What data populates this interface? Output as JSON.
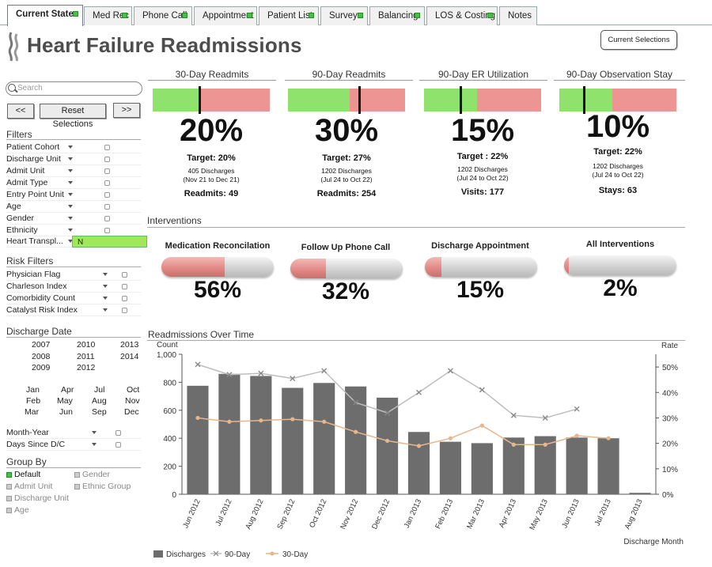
{
  "tabs": [
    {
      "label": "Current State",
      "active": true,
      "indicator": true
    },
    {
      "label": "Med Rec",
      "active": false,
      "indicator": true
    },
    {
      "label": "Phone Call",
      "active": false,
      "indicator": true
    },
    {
      "label": "Appointment",
      "active": false,
      "indicator": true
    },
    {
      "label": "Patient List",
      "active": false,
      "indicator": true
    },
    {
      "label": "Surveys",
      "active": false,
      "indicator": true
    },
    {
      "label": "Balancing",
      "active": false,
      "indicator": true
    },
    {
      "label": "LOS & Costing",
      "active": false,
      "indicator": true
    },
    {
      "label": "Notes",
      "active": false,
      "indicator": false
    }
  ],
  "header": {
    "title": "Heart Failure Readmissions",
    "current_selections_label": "Current Selections"
  },
  "left": {
    "search_placeholder": "Search",
    "prev_label": "<<",
    "reset_label": "Reset Selections",
    "next_label": ">>",
    "filters_title": "Filters",
    "filters": [
      "Patient Cohort",
      "Discharge Unit",
      "Admit Unit",
      "Admit Type",
      "Entry Point Unit",
      "Age",
      "Gender",
      "Ethnicity",
      "Heart Transpl..."
    ],
    "heart_transplant_value": "N",
    "risk_title": "Risk Filters",
    "risk_filters": [
      "Physician Flag",
      "Charleson Index",
      "Comorbidity Count",
      "Catalyst Risk Index"
    ],
    "discharge_date_title": "Discharge Date",
    "years": [
      "2007",
      "2010",
      "2013",
      "2008",
      "2011",
      "2014",
      "2009",
      "2012"
    ],
    "months": [
      "Jan",
      "Apr",
      "Jul",
      "Oct",
      "Feb",
      "May",
      "Aug",
      "Nov",
      "Mar",
      "Jun",
      "Sep",
      "Dec"
    ],
    "other_filters": [
      "Month-Year",
      "Days Since D/C"
    ],
    "group_by_title": "Group By",
    "group_by_left": [
      "Default",
      "Admit Unit",
      "Discharge Unit",
      "Age"
    ],
    "group_by_right": [
      "Gender",
      "Ethnic Group"
    ],
    "group_by_selected": "Default"
  },
  "kpis": [
    {
      "title": "30-Day Readmits",
      "value": "20%",
      "target": "Target: 20%",
      "discharges": "405 Discharges",
      "range": "(Nov 21 to Dec 21)",
      "footer": "Readmits: 49",
      "green_fraction": 0.41,
      "marker_fraction": 0.4
    },
    {
      "title": "90-Day Readmits",
      "value": "30%",
      "target": "Target: 27%",
      "discharges": "1202 Discharges",
      "range": "(Jul 24 to Oct 22)",
      "footer": "Readmits: 254",
      "green_fraction": 0.53,
      "marker_fraction": 0.61
    },
    {
      "title": "90-Day ER Utilization",
      "value": "15%",
      "target": "Target : 22%",
      "discharges": "1202 Discharges",
      "range": "(Jul 24 to Oct 22)",
      "footer": "Visits:  177",
      "green_fraction": 0.45,
      "marker_fraction": 0.31
    },
    {
      "title": "90-Day Observation Stay",
      "value": "10%",
      "target": "Target: 22%",
      "discharges": "1202 Discharges",
      "range": "(Jul 24 to Oct 22)",
      "footer": "Stays: 63",
      "green_fraction": 0.45,
      "marker_fraction": 0.21
    }
  ],
  "interventions_title": "Interventions",
  "interventions": [
    {
      "title": "Medication Reconcilation",
      "value": "56%",
      "fraction": 0.56
    },
    {
      "title": "Follow Up Phone Call",
      "value": "32%",
      "fraction": 0.32
    },
    {
      "title": "Discharge Appointment",
      "value": "15%",
      "fraction": 0.15
    },
    {
      "title": "All Interventions",
      "value": "2%",
      "fraction": 0.02
    }
  ],
  "chart_section_title": "Readmissions Over Time",
  "colors": {
    "gauge_green": "#8fe26b",
    "gauge_red": "#ec9593",
    "bar": "#6d6d6d",
    "line_90": "#bdbdbd",
    "line_30": "#e6b68c",
    "active_indicator": "#48c048"
  },
  "chart_data": {
    "type": "bar",
    "title": "Readmissions Over Time",
    "xlabel": "Discharge Month",
    "ylabel_left": "Count",
    "ylabel_right": "Rate",
    "ylim_left": [
      0,
      1000
    ],
    "ylim_right": [
      0,
      0.55
    ],
    "left_ticks": [
      "0",
      "200",
      "400",
      "600",
      "800",
      "1,000"
    ],
    "right_ticks": [
      "0%",
      "10%",
      "20%",
      "30%",
      "40%",
      "50%"
    ],
    "categories": [
      "Jun 2012",
      "Jul 2012",
      "Aug 2012",
      "Sep 2012",
      "Oct 2012",
      "Nov 2012",
      "Dec 2012",
      "Jan 2013",
      "Feb 2013",
      "Mar 2013",
      "Apr 2013",
      "May 2013",
      "Jun 2013",
      "Jul 2013",
      "Aug 2013"
    ],
    "series": [
      {
        "name": "Discharges",
        "kind": "bar",
        "axis": "left",
        "values": [
          775,
          860,
          845,
          760,
          795,
          770,
          690,
          445,
          375,
          365,
          405,
          415,
          405,
          400,
          10
        ]
      },
      {
        "name": "90-Day",
        "kind": "line",
        "axis": "right",
        "values": [
          0.51,
          0.47,
          0.475,
          0.455,
          0.485,
          0.36,
          0.32,
          0.4,
          0.485,
          0.41,
          0.31,
          0.3,
          0.335,
          null,
          null
        ]
      },
      {
        "name": "30-Day",
        "kind": "line",
        "axis": "right",
        "values": [
          0.3,
          0.285,
          0.29,
          0.295,
          0.285,
          0.245,
          0.21,
          0.19,
          0.22,
          0.27,
          0.195,
          0.195,
          0.23,
          0.22,
          null
        ]
      }
    ],
    "legend": [
      "Discharges",
      "90-Day",
      "30-Day"
    ],
    "legend_position": "bottom-left",
    "grid": false
  }
}
